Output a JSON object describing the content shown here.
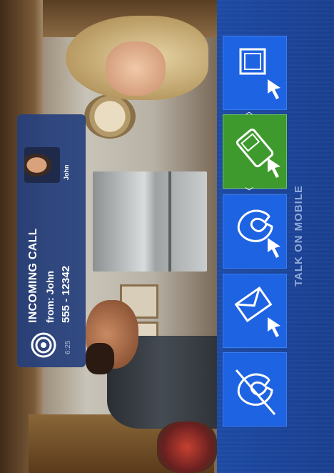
{
  "notification": {
    "title": "INCOMING CALL",
    "from": "from: John",
    "phone": "555 - 12342",
    "time": "6:25",
    "caller_name": "John"
  },
  "panel": {
    "label": "TALK ON MOBILE",
    "tiles": [
      {
        "icon": "stop-square-icon",
        "active": false
      },
      {
        "icon": "mobile-phone-icon",
        "active": true
      },
      {
        "icon": "phone-handset-icon",
        "active": false
      },
      {
        "icon": "envelope-icon",
        "active": false
      },
      {
        "icon": "end-call-icon",
        "active": false
      }
    ]
  },
  "colors": {
    "panel_blue": "#1d4aa4",
    "tile_blue": "#1e63e2",
    "tile_active_green": "#3f9a2e",
    "card_blue": "#25407d"
  }
}
